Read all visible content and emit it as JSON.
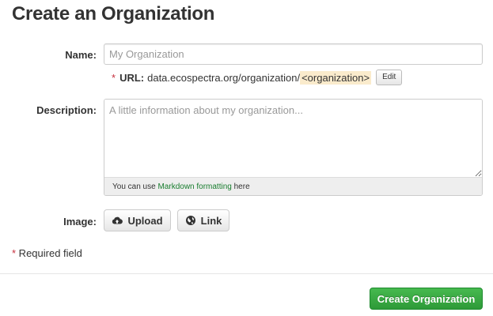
{
  "page": {
    "title": "Create an Organization"
  },
  "form": {
    "name": {
      "label": "Name:",
      "value": "",
      "placeholder": "My Organization"
    },
    "url": {
      "required_marker": "*",
      "label": "URL:",
      "base": "data.ecospectra.org/organization/",
      "slug": "<organization>",
      "edit_label": "Edit"
    },
    "description": {
      "label": "Description:",
      "value": "",
      "placeholder": "A little information about my organization...",
      "markdown_prefix": "You can use ",
      "markdown_link": "Markdown formatting",
      "markdown_suffix": " here"
    },
    "image": {
      "label": "Image:",
      "upload_label": "Upload",
      "upload_icon": "cloud-upload-icon",
      "link_label": "Link",
      "link_icon": "globe-icon"
    },
    "required_note": {
      "marker": "*",
      "text": " Required field"
    },
    "submit_label": "Create Organization"
  },
  "colors": {
    "required": "#c6303e",
    "slug_highlight": "#faebcc",
    "link": "#187d2e",
    "primary_button": "#3aa844"
  }
}
